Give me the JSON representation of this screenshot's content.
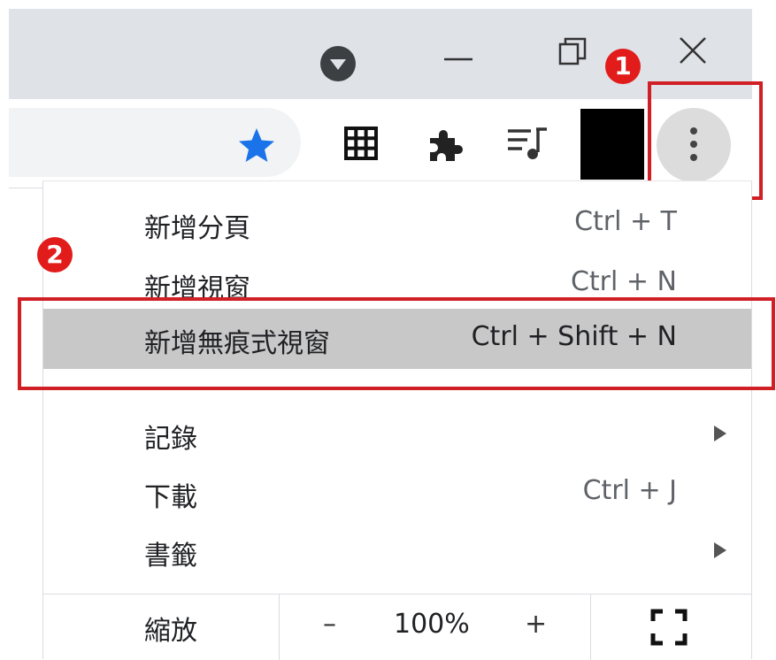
{
  "titlebar": {
    "profile_icon": "dropdown-circle-icon",
    "minimize_icon": "minimize-icon",
    "restore_icon": "restore-icon",
    "close_icon": "close-icon"
  },
  "toolbar": {
    "bookmark_star_icon": "star-icon",
    "apps_icon": "grid-icon",
    "extensions_icon": "puzzle-icon",
    "media_icon": "media-playlist-icon",
    "avatar_icon": "avatar-block",
    "menu_icon": "kebab-menu-icon"
  },
  "annotations": {
    "step1": "1",
    "step2": "2"
  },
  "menu": {
    "items": [
      {
        "label": "新增分頁",
        "shortcut": "Ctrl + T"
      },
      {
        "label": "新增視窗",
        "shortcut": "Ctrl + N"
      },
      {
        "label": "新增無痕式視窗",
        "shortcut": "Ctrl + Shift + N"
      },
      {
        "label": "記錄",
        "shortcut": ""
      },
      {
        "label": "下載",
        "shortcut": "Ctrl + J"
      },
      {
        "label": "書籤",
        "shortcut": ""
      }
    ],
    "zoom": {
      "label": "縮放",
      "minus": "–",
      "value": "100%",
      "plus": "+",
      "fullscreen_icon": "fullscreen-icon"
    }
  },
  "colors": {
    "highlight": "#c8c8c8",
    "annotation_red": "#d11f26",
    "star_blue": "#1a73e8"
  }
}
